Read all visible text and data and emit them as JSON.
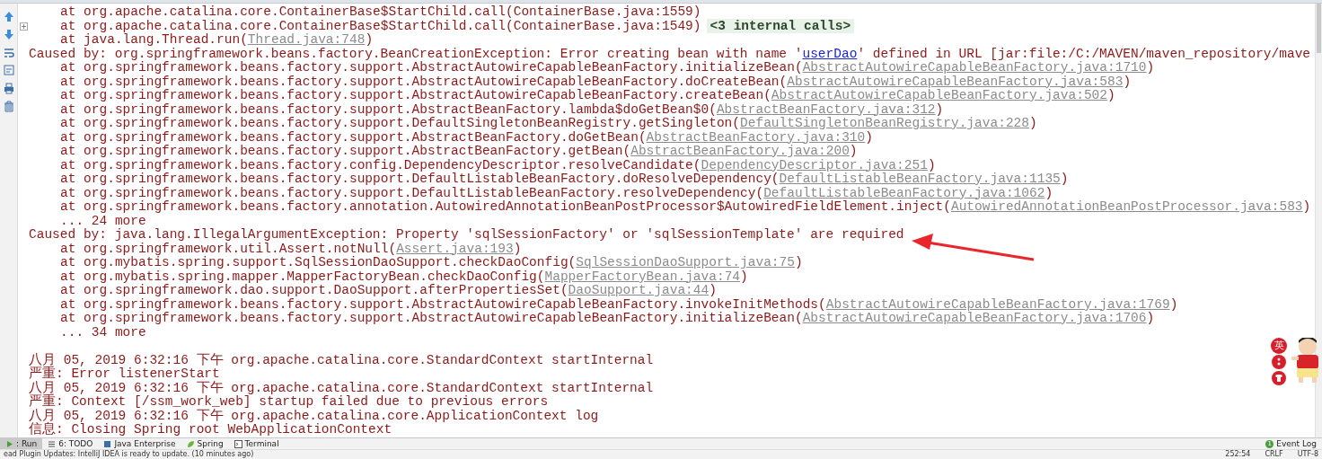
{
  "console": {
    "lines": [
      {
        "kind": "frame",
        "text": "at org.apache.catalina.core.ContainerBase$StartChild.call(ContainerBase.java:1559)"
      },
      {
        "kind": "frame",
        "text": "at org.apache.catalina.core.ContainerBase$StartChild.call(ContainerBase.java:1549)",
        "folded": true,
        "note": "<3 internal calls>"
      },
      {
        "kind": "frame",
        "text": "at java.lang.Thread.run(",
        "link": "Thread.java:748",
        "after": ")"
      },
      {
        "kind": "cause",
        "text": "Caused by: org.springframework.beans.factory.BeanCreationException: Error creating bean with name '",
        "link": "userDao",
        "after": "' defined in URL [jar:file:/C:/MAVEN/maven_repository/mave"
      },
      {
        "kind": "frame",
        "text": "at org.springframework.beans.factory.support.AbstractAutowireCapableBeanFactory.initializeBean(",
        "link": "AbstractAutowireCapableBeanFactory.java:1710",
        "after": ")"
      },
      {
        "kind": "frame",
        "text": "at org.springframework.beans.factory.support.AbstractAutowireCapableBeanFactory.doCreateBean(",
        "link": "AbstractAutowireCapableBeanFactory.java:583",
        "after": ")"
      },
      {
        "kind": "frame",
        "text": "at org.springframework.beans.factory.support.AbstractAutowireCapableBeanFactory.createBean(",
        "link": "AbstractAutowireCapableBeanFactory.java:502",
        "after": ")"
      },
      {
        "kind": "frame",
        "text": "at org.springframework.beans.factory.support.AbstractBeanFactory.lambda$doGetBean$0(",
        "link": "AbstractBeanFactory.java:312",
        "after": ")"
      },
      {
        "kind": "frame",
        "text": "at org.springframework.beans.factory.support.DefaultSingletonBeanRegistry.getSingleton(",
        "link": "DefaultSingletonBeanRegistry.java:228",
        "after": ")"
      },
      {
        "kind": "frame",
        "text": "at org.springframework.beans.factory.support.AbstractBeanFactory.doGetBean(",
        "link": "AbstractBeanFactory.java:310",
        "after": ")"
      },
      {
        "kind": "frame",
        "text": "at org.springframework.beans.factory.support.AbstractBeanFactory.getBean(",
        "link": "AbstractBeanFactory.java:200",
        "after": ")"
      },
      {
        "kind": "frame",
        "text": "at org.springframework.beans.factory.config.DependencyDescriptor.resolveCandidate(",
        "link": "DependencyDescriptor.java:251",
        "after": ")"
      },
      {
        "kind": "frame",
        "text": "at org.springframework.beans.factory.support.DefaultListableBeanFactory.doResolveDependency(",
        "link": "DefaultListableBeanFactory.java:1135",
        "after": ")"
      },
      {
        "kind": "frame",
        "text": "at org.springframework.beans.factory.support.DefaultListableBeanFactory.resolveDependency(",
        "link": "DefaultListableBeanFactory.java:1062",
        "after": ")"
      },
      {
        "kind": "frame",
        "text": "at org.springframework.beans.factory.annotation.AutowiredAnnotationBeanPostProcessor$AutowiredFieldElement.inject(",
        "link": "AutowiredAnnotationBeanPostProcessor.java:583",
        "after": ")"
      },
      {
        "kind": "frame",
        "text": "... 24 more"
      },
      {
        "kind": "cause",
        "text": "Caused by: java.lang.IllegalArgumentException: Property 'sqlSessionFactory' or 'sqlSessionTemplate' are required"
      },
      {
        "kind": "frame",
        "text": "at org.springframework.util.Assert.notNull(",
        "link": "Assert.java:193",
        "after": ")"
      },
      {
        "kind": "frame",
        "text": "at org.mybatis.spring.support.SqlSessionDaoSupport.checkDaoConfig(",
        "link": "SqlSessionDaoSupport.java:75",
        "after": ")"
      },
      {
        "kind": "frame",
        "text": "at org.mybatis.spring.mapper.MapperFactoryBean.checkDaoConfig(",
        "link": "MapperFactoryBean.java:74",
        "after": ")"
      },
      {
        "kind": "frame",
        "text": "at org.springframework.dao.support.DaoSupport.afterPropertiesSet(",
        "link": "DaoSupport.java:44",
        "after": ")"
      },
      {
        "kind": "frame",
        "text": "at org.springframework.beans.factory.support.AbstractAutowireCapableBeanFactory.invokeInitMethods(",
        "link": "AbstractAutowireCapableBeanFactory.java:1769",
        "after": ")"
      },
      {
        "kind": "frame",
        "text": "at org.springframework.beans.factory.support.AbstractAutowireCapableBeanFactory.initializeBean(",
        "link": "AbstractAutowireCapableBeanFactory.java:1706",
        "after": ")"
      },
      {
        "kind": "frame",
        "text": "... 34 more"
      },
      {
        "kind": "blank"
      },
      {
        "kind": "log",
        "text": "八月 05, 2019 6:32:16 下午 org.apache.catalina.core.StandardContext startInternal"
      },
      {
        "kind": "log",
        "text": "严重: Error listenerStart"
      },
      {
        "kind": "log",
        "text": "八月 05, 2019 6:32:16 下午 org.apache.catalina.core.StandardContext startInternal"
      },
      {
        "kind": "log",
        "text": "严重: Context [/ssm_work_web] startup failed due to previous errors"
      },
      {
        "kind": "log",
        "text": "八月 05, 2019 6:32:16 下午 org.apache.catalina.core.ApplicationContext log"
      },
      {
        "kind": "log",
        "text": "信息: Closing Spring root WebApplicationContext"
      }
    ]
  },
  "ime": {
    "label": "英"
  },
  "tool_tabs": [
    {
      "label": ": Run",
      "selected": true
    },
    {
      "label": "6: TODO",
      "selected": false
    },
    {
      "label": "Java Enterprise",
      "selected": false
    },
    {
      "label": "Spring",
      "selected": false
    },
    {
      "label": "Terminal",
      "selected": false
    }
  ],
  "event_log": {
    "label": "Event Log",
    "count": "1"
  },
  "status_bar": {
    "message": "ead Plugin Updates: IntelliJ IDEA is ready to update. (10 minutes ago)",
    "items": [
      "252:54",
      "CRLF",
      "UTF-8"
    ]
  }
}
